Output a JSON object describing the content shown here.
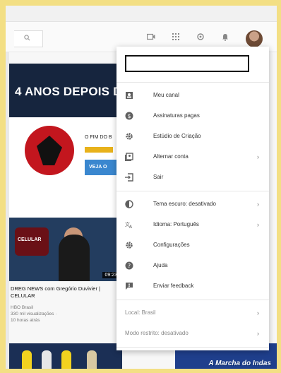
{
  "menu": {
    "items": [
      {
        "label": "Meu canal",
        "icon": "person-icon",
        "chevron": false
      },
      {
        "label": "Assinaturas pagas",
        "icon": "dollar-icon",
        "chevron": false
      },
      {
        "label": "Estúdio de Criação",
        "icon": "gear-icon",
        "chevron": false
      },
      {
        "label": "Alternar conta",
        "icon": "switch-account-icon",
        "chevron": true
      },
      {
        "label": "Sair",
        "icon": "sign-out-icon",
        "chevron": false
      }
    ],
    "settings": [
      {
        "label": "Tema escuro: desativado",
        "icon": "dark-theme-icon",
        "chevron": true
      },
      {
        "label": "Idioma: Português",
        "icon": "language-icon",
        "chevron": true
      },
      {
        "label": "Configurações",
        "icon": "settings-icon",
        "chevron": false
      },
      {
        "label": "Ajuda",
        "icon": "help-icon",
        "chevron": false
      },
      {
        "label": "Enviar feedback",
        "icon": "feedback-icon",
        "chevron": false
      }
    ],
    "footer": [
      {
        "label": "Local: Brasil",
        "chevron": true
      },
      {
        "label": "Modo restrito: desativado",
        "chevron": true
      }
    ]
  },
  "page": {
    "banner_text": "4 ANOS DEPOIS D",
    "channel_name": "O FIM DO B",
    "subscribe_label": "VEJA O",
    "video": {
      "logo_text": "CELULAR",
      "duration": "09:23",
      "title": "DREG NEWS com Gregório Duvivier | CELULAR",
      "channel": "HBO Brasil",
      "views": "330 mil visualizações ·",
      "age": "10 horas atrás"
    },
    "thumb3_text": "A Marcha do Indas"
  },
  "colors": {
    "accent_blue": "#3a87cf",
    "frame_border": "#f3df84",
    "channel_red": "#c3161e"
  }
}
